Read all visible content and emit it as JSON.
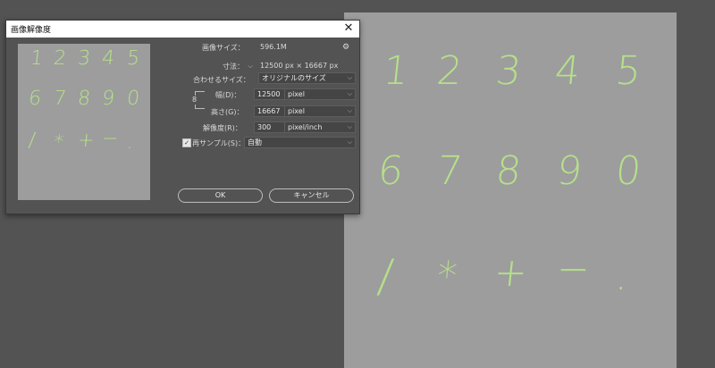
{
  "dialog": {
    "title": "画像解像度",
    "close_glyph": "✕",
    "image_size_label": "画像サイズ：",
    "image_size_value": "596.1M",
    "dimensions_label": "寸法：",
    "dimensions_value": "12500 px × 16667 px",
    "fit_label": "合わせるサイズ：",
    "fit_value": "オリジナルのサイズ",
    "width_label": "幅(D)：",
    "width_value": "12500",
    "width_unit": "pixel",
    "height_label": "高さ(G)：",
    "height_value": "16667",
    "height_unit": "pixel",
    "resolution_label": "解像度(R)：",
    "resolution_value": "300",
    "resolution_unit": "pixel/inch",
    "resample_label": "再サンプル(S)：",
    "resample_checked": true,
    "resample_value": "自動",
    "ok_label": "OK",
    "cancel_label": "キャンセル"
  },
  "canvas": {
    "row1": [
      "1",
      "2",
      "3",
      "4",
      "5"
    ],
    "row2": [
      "6",
      "7",
      "8",
      "9",
      "0"
    ],
    "row3": [
      "/",
      "*",
      "+",
      "−",
      "."
    ]
  },
  "icons": {
    "gear": "gear-icon",
    "close": "close-icon",
    "chevron": "chevron-down-icon",
    "link": "link-icon"
  },
  "colors": {
    "workspace": "#535353",
    "canvas": "#9d9d9d",
    "stroke": "#b5e08a"
  }
}
